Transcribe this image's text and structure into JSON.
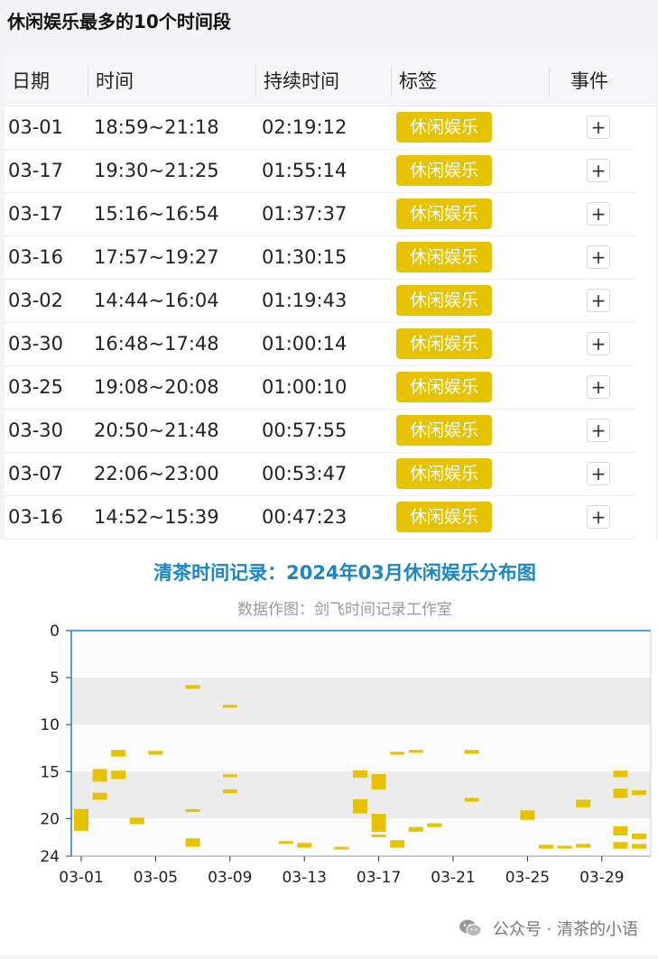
{
  "page_title": "休闲娱乐最多的10个时间段",
  "table": {
    "headers": [
      "日期",
      "时间",
      "持续时间",
      "标签",
      "事件"
    ],
    "rows": [
      {
        "date": "03-01",
        "time": "18:59~21:18",
        "duration": "02:19:12",
        "tag": "休闲娱乐"
      },
      {
        "date": "03-17",
        "time": "19:30~21:25",
        "duration": "01:55:14",
        "tag": "休闲娱乐"
      },
      {
        "date": "03-17",
        "time": "15:16~16:54",
        "duration": "01:37:37",
        "tag": "休闲娱乐"
      },
      {
        "date": "03-16",
        "time": "17:57~19:27",
        "duration": "01:30:15",
        "tag": "休闲娱乐"
      },
      {
        "date": "03-02",
        "time": "14:44~16:04",
        "duration": "01:19:43",
        "tag": "休闲娱乐"
      },
      {
        "date": "03-30",
        "time": "16:48~17:48",
        "duration": "01:00:14",
        "tag": "休闲娱乐"
      },
      {
        "date": "03-25",
        "time": "19:08~20:08",
        "duration": "01:00:10",
        "tag": "休闲娱乐"
      },
      {
        "date": "03-30",
        "time": "20:50~21:48",
        "duration": "00:57:55",
        "tag": "休闲娱乐"
      },
      {
        "date": "03-07",
        "time": "22:06~23:00",
        "duration": "00:53:47",
        "tag": "休闲娱乐"
      },
      {
        "date": "03-16",
        "time": "14:52~15:39",
        "duration": "00:47:23",
        "tag": "休闲娱乐"
      }
    ],
    "event_button_label": "+"
  },
  "chart_data": {
    "type": "bar",
    "title": "清茶时间记录：2024年03月休闲娱乐分布图",
    "subtitle": "数据作图：剑飞时间记录工作室",
    "x_ticks": [
      "03-01",
      "03-05",
      "03-09",
      "03-13",
      "03-17",
      "03-21",
      "03-25",
      "03-29"
    ],
    "x_range": [
      "03-01",
      "03-31"
    ],
    "y_ticks": [
      0,
      5,
      10,
      15,
      20,
      24
    ],
    "y_range": [
      0,
      24
    ],
    "y_inverted": true,
    "colors": {
      "bar": "#e6c200",
      "title": "#1a86c8",
      "subtitle": "#999999",
      "band": "#ececec",
      "axis": "#1a86c8"
    },
    "segments": [
      {
        "day": 1,
        "start": 18.98,
        "end": 21.3
      },
      {
        "day": 2,
        "start": 14.73,
        "end": 16.07
      },
      {
        "day": 2,
        "start": 17.25,
        "end": 18.0
      },
      {
        "day": 3,
        "start": 12.7,
        "end": 13.4
      },
      {
        "day": 3,
        "start": 14.9,
        "end": 15.8
      },
      {
        "day": 4,
        "start": 19.9,
        "end": 20.6
      },
      {
        "day": 5,
        "start": 12.8,
        "end": 13.2
      },
      {
        "day": 7,
        "start": 5.8,
        "end": 6.2
      },
      {
        "day": 7,
        "start": 19.0,
        "end": 19.3
      },
      {
        "day": 7,
        "start": 22.1,
        "end": 23.0
      },
      {
        "day": 9,
        "start": 7.9,
        "end": 8.2
      },
      {
        "day": 9,
        "start": 15.3,
        "end": 15.6
      },
      {
        "day": 9,
        "start": 16.9,
        "end": 17.3
      },
      {
        "day": 12,
        "start": 22.4,
        "end": 22.7
      },
      {
        "day": 13,
        "start": 22.6,
        "end": 23.1
      },
      {
        "day": 15,
        "start": 23.0,
        "end": 23.2
      },
      {
        "day": 16,
        "start": 14.87,
        "end": 15.65
      },
      {
        "day": 16,
        "start": 17.95,
        "end": 19.45
      },
      {
        "day": 17,
        "start": 15.27,
        "end": 16.9
      },
      {
        "day": 17,
        "start": 19.5,
        "end": 21.42
      },
      {
        "day": 17,
        "start": 21.7,
        "end": 21.9
      },
      {
        "day": 18,
        "start": 12.9,
        "end": 13.2
      },
      {
        "day": 18,
        "start": 22.3,
        "end": 23.1
      },
      {
        "day": 19,
        "start": 12.7,
        "end": 13.0
      },
      {
        "day": 19,
        "start": 20.9,
        "end": 21.4
      },
      {
        "day": 20,
        "start": 20.5,
        "end": 20.9
      },
      {
        "day": 22,
        "start": 12.7,
        "end": 13.1
      },
      {
        "day": 22,
        "start": 17.8,
        "end": 18.2
      },
      {
        "day": 25,
        "start": 19.13,
        "end": 20.13
      },
      {
        "day": 26,
        "start": 22.8,
        "end": 23.2
      },
      {
        "day": 27,
        "start": 22.9,
        "end": 23.2
      },
      {
        "day": 28,
        "start": 18.0,
        "end": 18.8
      },
      {
        "day": 28,
        "start": 22.7,
        "end": 23.1
      },
      {
        "day": 30,
        "start": 14.9,
        "end": 15.6
      },
      {
        "day": 30,
        "start": 16.8,
        "end": 17.8
      },
      {
        "day": 30,
        "start": 20.83,
        "end": 21.8
      },
      {
        "day": 30,
        "start": 22.5,
        "end": 23.2
      },
      {
        "day": 31,
        "start": 17.0,
        "end": 17.5
      },
      {
        "day": 31,
        "start": 21.6,
        "end": 22.2
      },
      {
        "day": 31,
        "start": 22.7,
        "end": 23.2
      }
    ]
  },
  "footer": {
    "brand": "公众号 · 清茶的小语",
    "icon": "wechat-icon"
  }
}
